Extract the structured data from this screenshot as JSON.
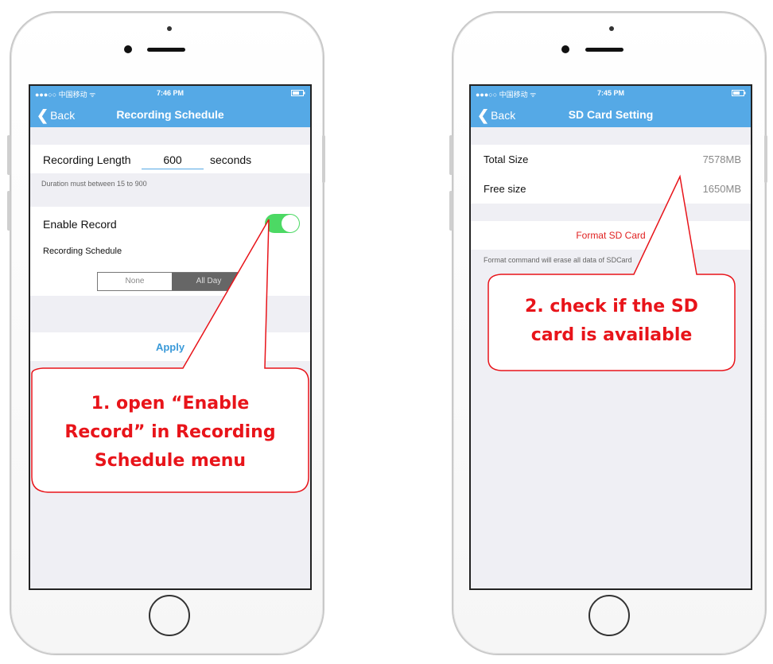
{
  "left_phone": {
    "status": {
      "carrier": "●●●○○ 中国移动 ᯤ",
      "time": "7:46 PM"
    },
    "nav": {
      "back": "Back",
      "title": "Recording Schedule"
    },
    "recording_length": {
      "label": "Recording Length",
      "value": "600",
      "unit": "seconds"
    },
    "duration_note": "Duration must between 15 to 900",
    "enable_record": {
      "label": "Enable Record",
      "on": true
    },
    "recording_schedule_label": "Recording Schedule",
    "segments": [
      "None",
      "All Day"
    ],
    "selected_segment": "All Day",
    "apply": "Apply"
  },
  "right_phone": {
    "status": {
      "carrier": "●●●○○ 中国移动 ᯤ",
      "time": "7:45 PM"
    },
    "nav": {
      "back": "Back",
      "title": "SD Card Setting"
    },
    "rows": [
      {
        "label": "Total Size",
        "value": "7578MB"
      },
      {
        "label": "Free size",
        "value": "1650MB"
      }
    ],
    "format_button": "Format SD Card",
    "format_note": "Format command will erase all data of SDCard"
  },
  "callouts": {
    "one": [
      "1. open “Enable",
      "Record” in Recording",
      "Schedule menu"
    ],
    "two": [
      "2. check if the SD",
      "card is available"
    ]
  },
  "colors": {
    "nav": "#55a9e6",
    "toggle_on": "#4cd964",
    "callout": "#e8141a",
    "segment_selected": "#666666"
  }
}
